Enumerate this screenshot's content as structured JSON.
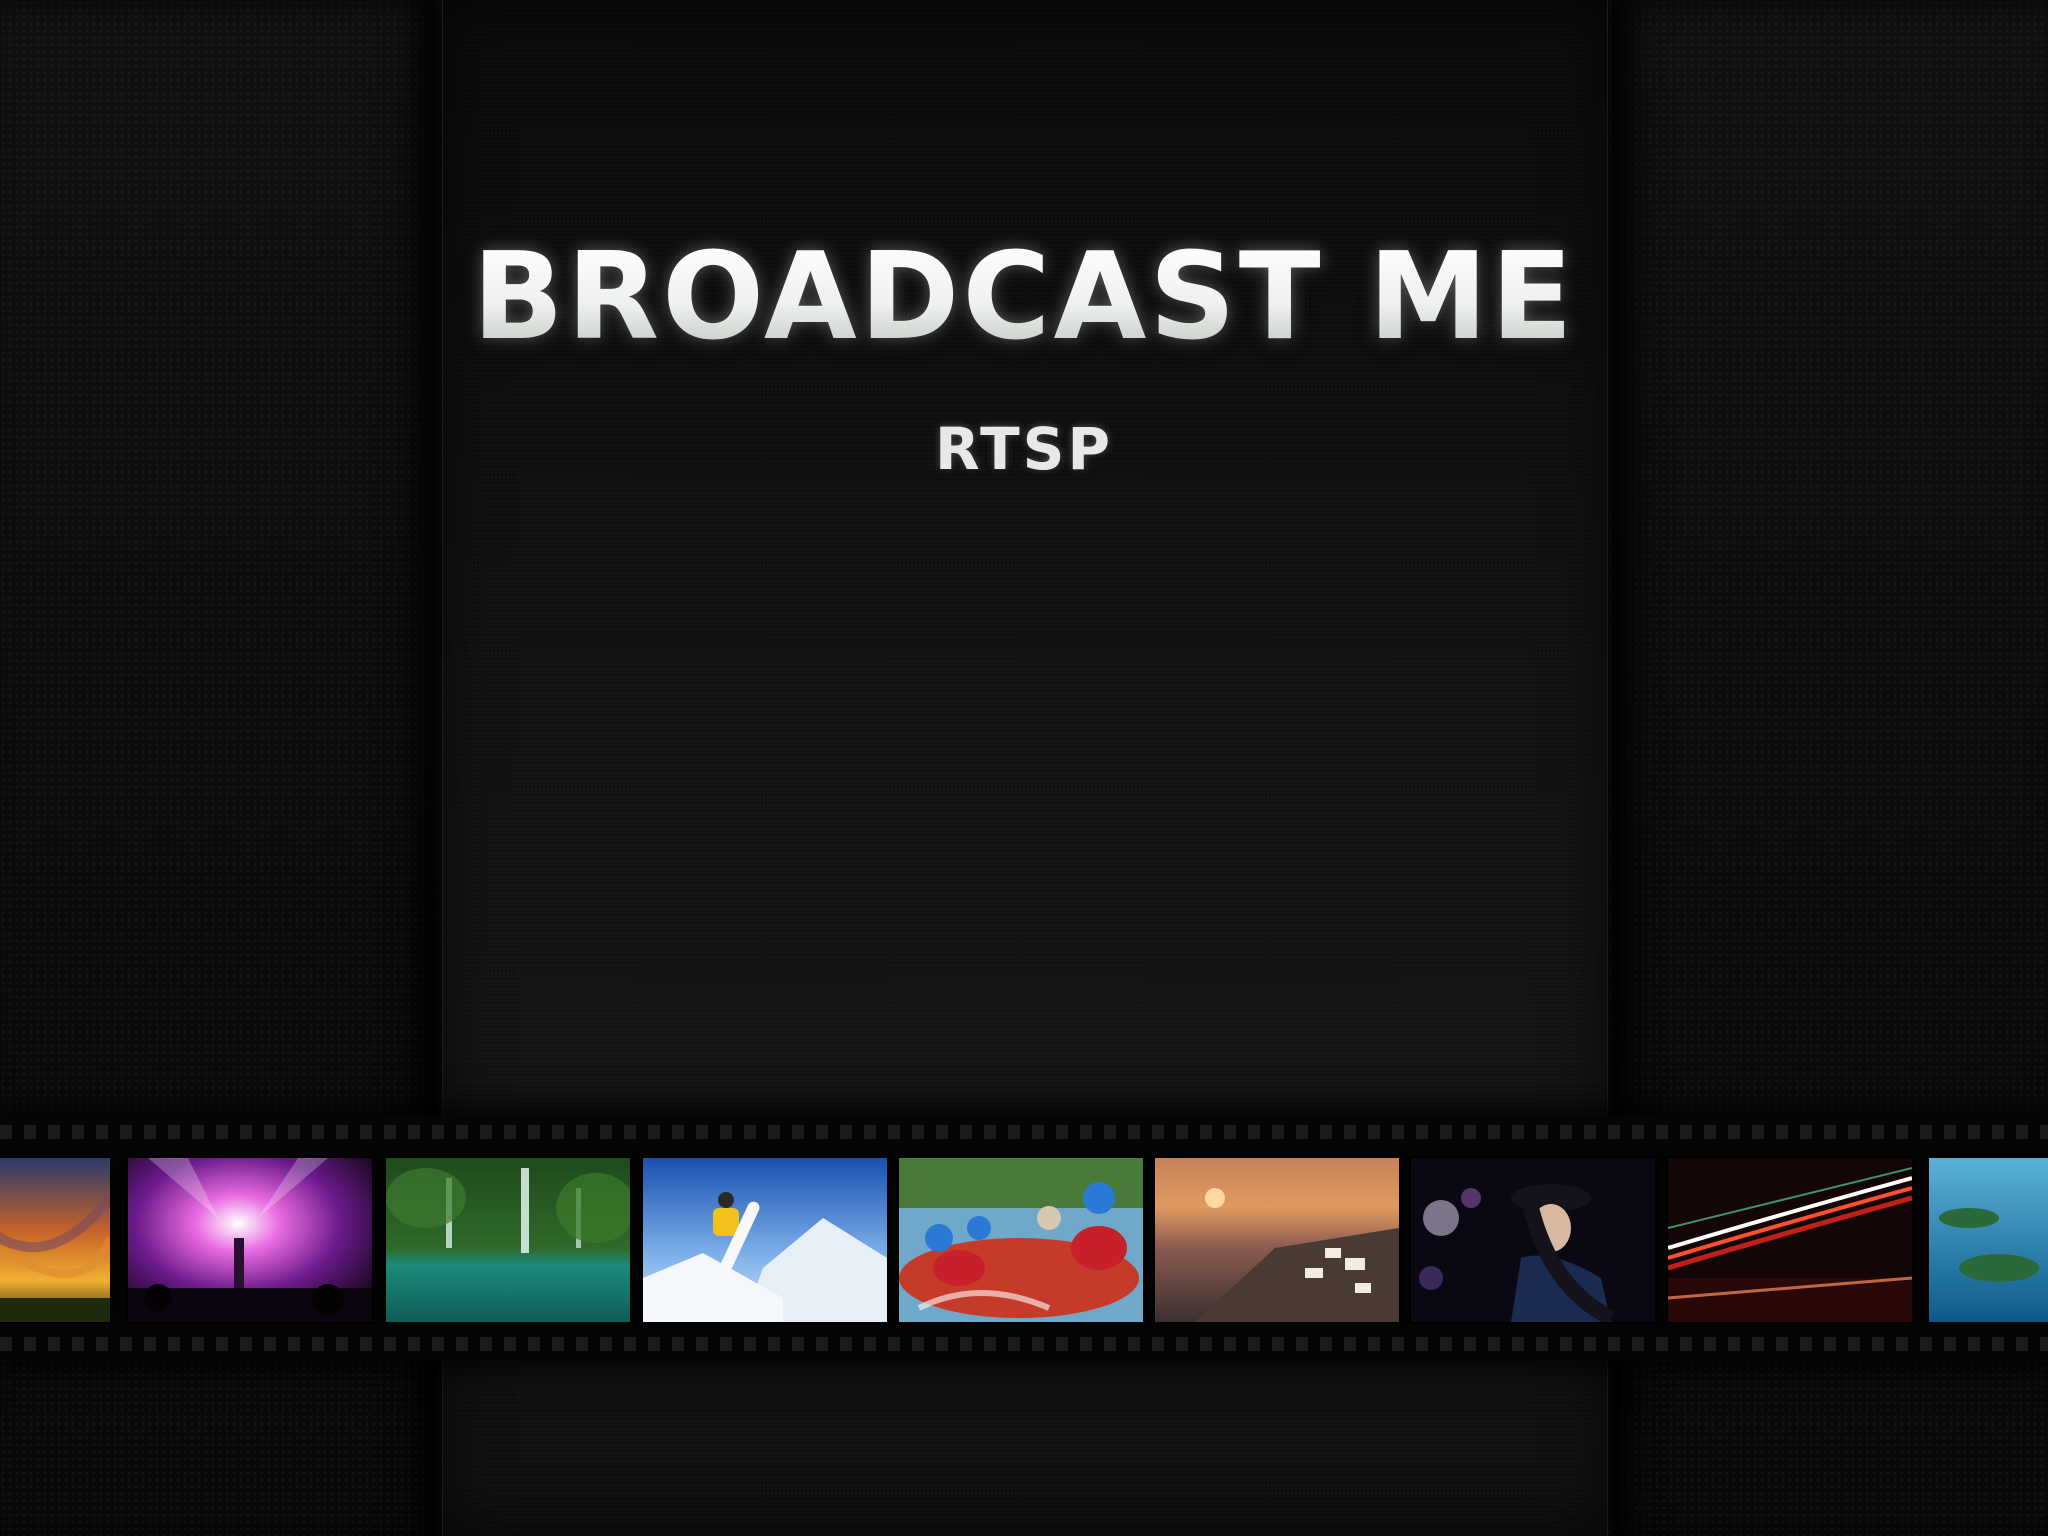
{
  "app": {
    "title": "BROADCAST ME",
    "subtitle": "RTSP"
  },
  "filmstrip": {
    "frames": [
      {
        "subject": "sunset-sky-photo"
      },
      {
        "subject": "concert-stage-photo"
      },
      {
        "subject": "waterfall-lagoon-photo"
      },
      {
        "subject": "snowboarder-photo"
      },
      {
        "subject": "river-rafting-photo"
      },
      {
        "subject": "coastal-sunset-village-photo"
      },
      {
        "subject": "woman-in-hat-bokeh-photo"
      },
      {
        "subject": "city-light-trails-photo"
      },
      {
        "subject": "tropical-islands-aerial-photo"
      }
    ]
  }
}
